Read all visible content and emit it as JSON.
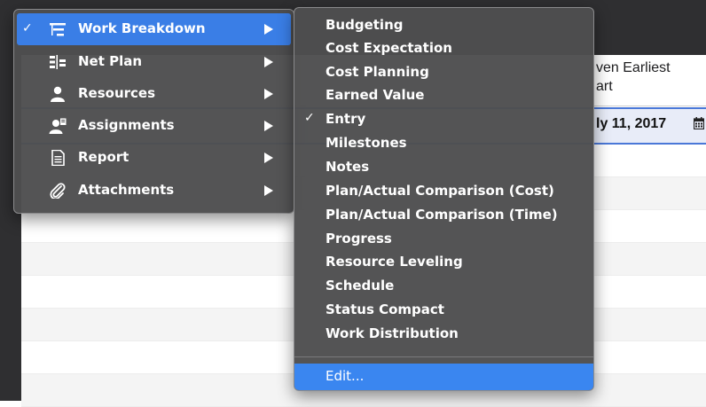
{
  "background": {
    "column_header": "ven Earliest\nart",
    "selected_date": "ly 11, 2017",
    "calendar_icon": "calendar-icon"
  },
  "colors": {
    "menu_background": "#4e4e50",
    "highlight": "#3a7ee6",
    "edit_highlight": "#3a86f0",
    "window_dark": "#2f2f31"
  },
  "view_menu": {
    "items": [
      {
        "label": "Work Breakdown",
        "icon": "work-breakdown-icon",
        "checked": true,
        "has_submenu": true,
        "highlighted": true
      },
      {
        "label": "Net Plan",
        "icon": "net-plan-icon",
        "checked": false,
        "has_submenu": true
      },
      {
        "label": "Resources",
        "icon": "person-icon",
        "checked": false,
        "has_submenu": true
      },
      {
        "label": "Assignments",
        "icon": "assignment-person-icon",
        "checked": false,
        "has_submenu": true
      },
      {
        "label": "Report",
        "icon": "document-icon",
        "checked": false,
        "has_submenu": true
      },
      {
        "label": "Attachments",
        "icon": "paperclip-icon",
        "checked": false,
        "has_submenu": true
      }
    ]
  },
  "submenu": {
    "items": [
      {
        "label": "Budgeting",
        "checked": false
      },
      {
        "label": "Cost Expectation",
        "checked": false
      },
      {
        "label": "Cost Planning",
        "checked": false
      },
      {
        "label": "Earned Value",
        "checked": false
      },
      {
        "label": "Entry",
        "checked": true
      },
      {
        "label": "Milestones",
        "checked": false
      },
      {
        "label": "Notes",
        "checked": false
      },
      {
        "label": "Plan/Actual Comparison (Cost)",
        "checked": false
      },
      {
        "label": "Plan/Actual Comparison (Time)",
        "checked": false
      },
      {
        "label": "Progress",
        "checked": false
      },
      {
        "label": "Resource Leveling",
        "checked": false
      },
      {
        "label": "Schedule",
        "checked": false
      },
      {
        "label": "Status Compact",
        "checked": false
      },
      {
        "label": "Work Distribution",
        "checked": false
      }
    ],
    "edit_label": "Edit...",
    "check_mark": "✓"
  },
  "check_mark": "✓"
}
